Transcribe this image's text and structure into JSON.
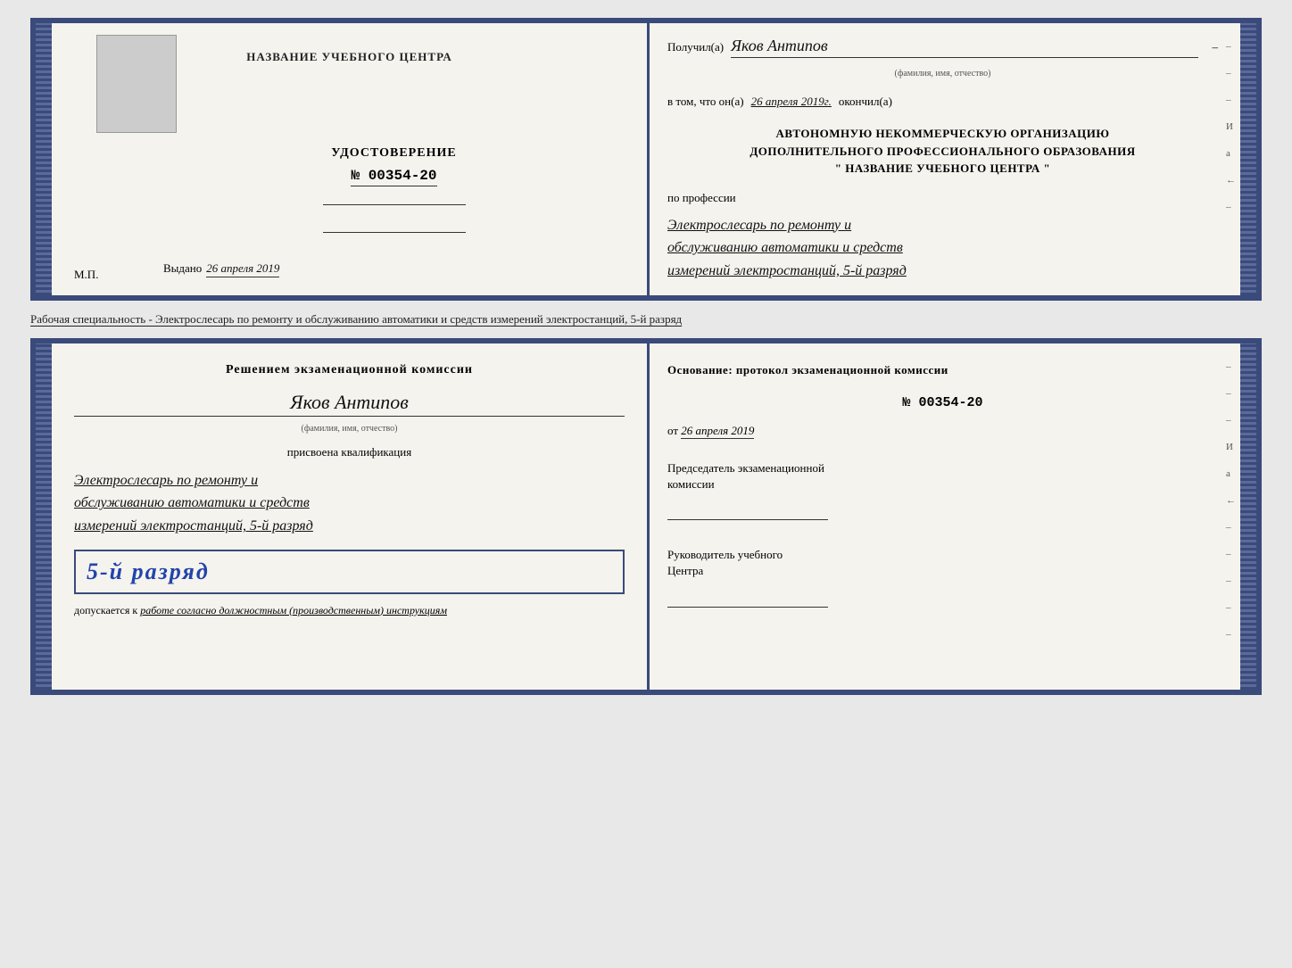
{
  "top_document": {
    "left": {
      "center_title": "НАЗВАНИЕ УЧЕБНОГО ЦЕНТРА",
      "cert_label": "УДОСТОВЕРЕНИЕ",
      "cert_number": "№ 00354-20",
      "issued_prefix": "Выдано",
      "issued_date": "26 апреля 2019",
      "mp_label": "М.П."
    },
    "right": {
      "recipient_prefix": "Получил(а)",
      "recipient_name": "Яков Антипов",
      "name_sub": "(фамилия, имя, отчество)",
      "date_prefix": "в том, что он(а)",
      "date_value": "26 апреля 2019г.",
      "date_suffix": "окончил(а)",
      "org_line1": "АВТОНОМНУЮ НЕКОММЕРЧЕСКУЮ ОРГАНИЗАЦИЮ",
      "org_line2": "ДОПОЛНИТЕЛЬНОГО ПРОФЕССИОНАЛЬНОГО ОБРАЗОВАНИЯ",
      "org_name": "\"  НАЗВАНИЕ УЧЕБНОГО ЦЕНТРА  \"",
      "profession_prefix": "по профессии",
      "profession_line1": "Электрослесарь по ремонту и",
      "profession_line2": "обслуживанию автоматики и средств",
      "profession_line3": "измерений электростанций, 5-й разряд"
    }
  },
  "separator": {
    "text": "Рабочая специальность - Электрослесарь по ремонту и обслуживанию автоматики и средств измерений электростанций, 5-й разряд"
  },
  "bottom_document": {
    "left": {
      "commission_title_line1": "Решением экзаменационной комиссии",
      "person_name": "Яков Антипов",
      "name_sub": "(фамилия, имя, отчество)",
      "assigned_label": "присвоена квалификация",
      "qual_line1": "Электрослесарь по ремонту и",
      "qual_line2": "обслуживанию автоматики и средств",
      "qual_line3": "измерений электростанций, 5-й разряд",
      "rank_text": "5-й разряд",
      "допускается_prefix": "допускается к",
      "допускается_text": "работе согласно должностным (производственным) инструкциям"
    },
    "right": {
      "basis_label": "Основание: протокол экзаменационной комиссии",
      "protocol_number": "№ 00354-20",
      "protocol_date_prefix": "от",
      "protocol_date": "26 апреля 2019",
      "chairman_line1": "Председатель экзаменационной",
      "chairman_line2": "комиссии",
      "director_line1": "Руководитель учебного",
      "director_line2": "Центра"
    }
  },
  "side_marks": [
    "-",
    "-",
    "-",
    "И",
    "а",
    "←",
    "-",
    "-",
    "-",
    "-",
    "-"
  ]
}
